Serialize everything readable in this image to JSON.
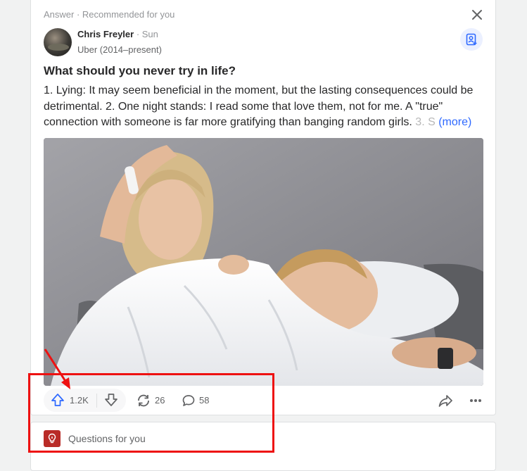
{
  "post": {
    "meta": "Answer · Recommended for you",
    "author_name": "Chris Freyler",
    "author_sep": " · ",
    "author_when": "Sun",
    "author_credential": "Uber (2014–present)",
    "question": "What should you never try in life?",
    "body_main": "1. Lying: It may seem beneficial in the moment, but the lasting consequences could be detrimental. 2. One night stands: I read some that love them, not for me. A \"true\" connection with someone is far more gratifying than banging random girls.",
    "body_fade": " 3. S",
    "body_more": "(more)"
  },
  "actions": {
    "upvotes": "1.2K",
    "shares": "26",
    "comments": "58"
  },
  "questions_card": {
    "label": "Questions for you"
  },
  "icons": {
    "close": "close-icon",
    "follow": "add-person-icon",
    "upvote": "arrow-up-icon",
    "downvote": "arrow-down-icon",
    "share": "reshare-icon",
    "comment": "comment-icon",
    "forward": "forward-share-icon",
    "more": "more-dots-icon",
    "questions": "lightbulb-icon"
  },
  "colors": {
    "accent": "#2e69ff",
    "brand_red": "#b92b27",
    "annotation_red": "#ee1111"
  }
}
